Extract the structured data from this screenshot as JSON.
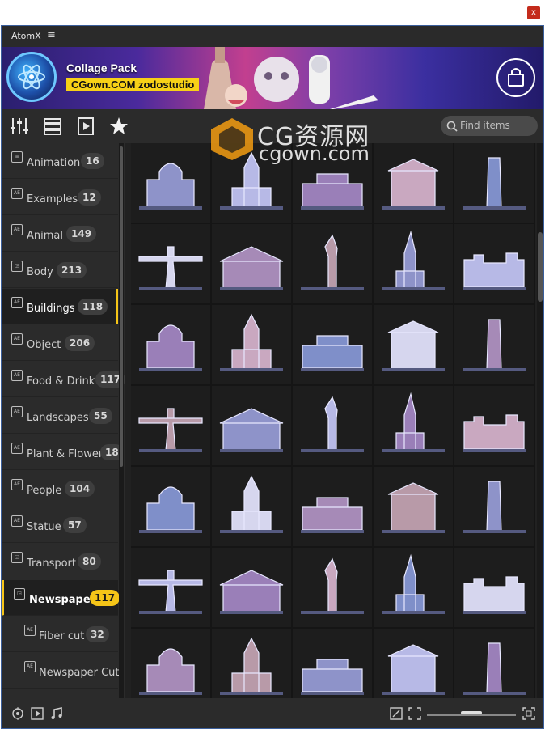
{
  "window": {
    "title": "AtomX",
    "close_label": "x"
  },
  "banner": {
    "pack_title": "Collage Pack",
    "pack_subtitle": "CGown.COM zodostudio"
  },
  "toolbar": {
    "search_placeholder": "Find items"
  },
  "watermark": {
    "line1": "CG资源网",
    "line2": "cgown.com"
  },
  "sidebar": {
    "categories": [
      {
        "label": "Animation",
        "count": "16"
      },
      {
        "label": "Examples",
        "count": "12"
      },
      {
        "label": "Animal",
        "count": "149"
      },
      {
        "label": "Body",
        "count": "213"
      },
      {
        "label": "Buildings",
        "count": "118"
      },
      {
        "label": "Object",
        "count": "206"
      },
      {
        "label": "Food & Drink",
        "count": "117"
      },
      {
        "label": "Landscapes",
        "count": "55"
      },
      {
        "label": "Plant & Flower",
        "count": "18"
      },
      {
        "label": "People",
        "count": "104"
      },
      {
        "label": "Statue",
        "count": "57"
      },
      {
        "label": "Transport",
        "count": "80"
      },
      {
        "label": "Newspaper",
        "count": "117"
      },
      {
        "label": "Fiber cut",
        "count": "32"
      },
      {
        "label": "Newspaper Cut",
        "count": ""
      }
    ],
    "icon_text": "AE"
  },
  "colors": {
    "accent": "#f5c518",
    "banner_badge": "#f7d117",
    "frame": "#3b5f9c"
  },
  "grid": {
    "items": [
      "church-dome",
      "tower-bridge-tower",
      "palace",
      "greek-temple",
      "leaning-tower",
      "christ-statue",
      "parthenon",
      "statue-of-liberty",
      "empire-state",
      "castle-walls",
      "arc-de-triomphe",
      "gothic-cathedral",
      "medieval-town",
      "pagoda",
      "hill-castle",
      "capitol-dome",
      "eiffel-tower",
      "colosseum",
      "ruins-columns",
      "temple-front",
      "petra-rock",
      "colosseum-wall",
      "stone-tower",
      "ancient-ruins",
      "skyscrapers",
      "fortress",
      "temple-pillars",
      "baroque-building",
      "notre-dame",
      "gothic-hall",
      "round-tower",
      "modern-block",
      "colosseum-arches",
      "cathedral-long",
      "ruined-tower"
    ]
  }
}
